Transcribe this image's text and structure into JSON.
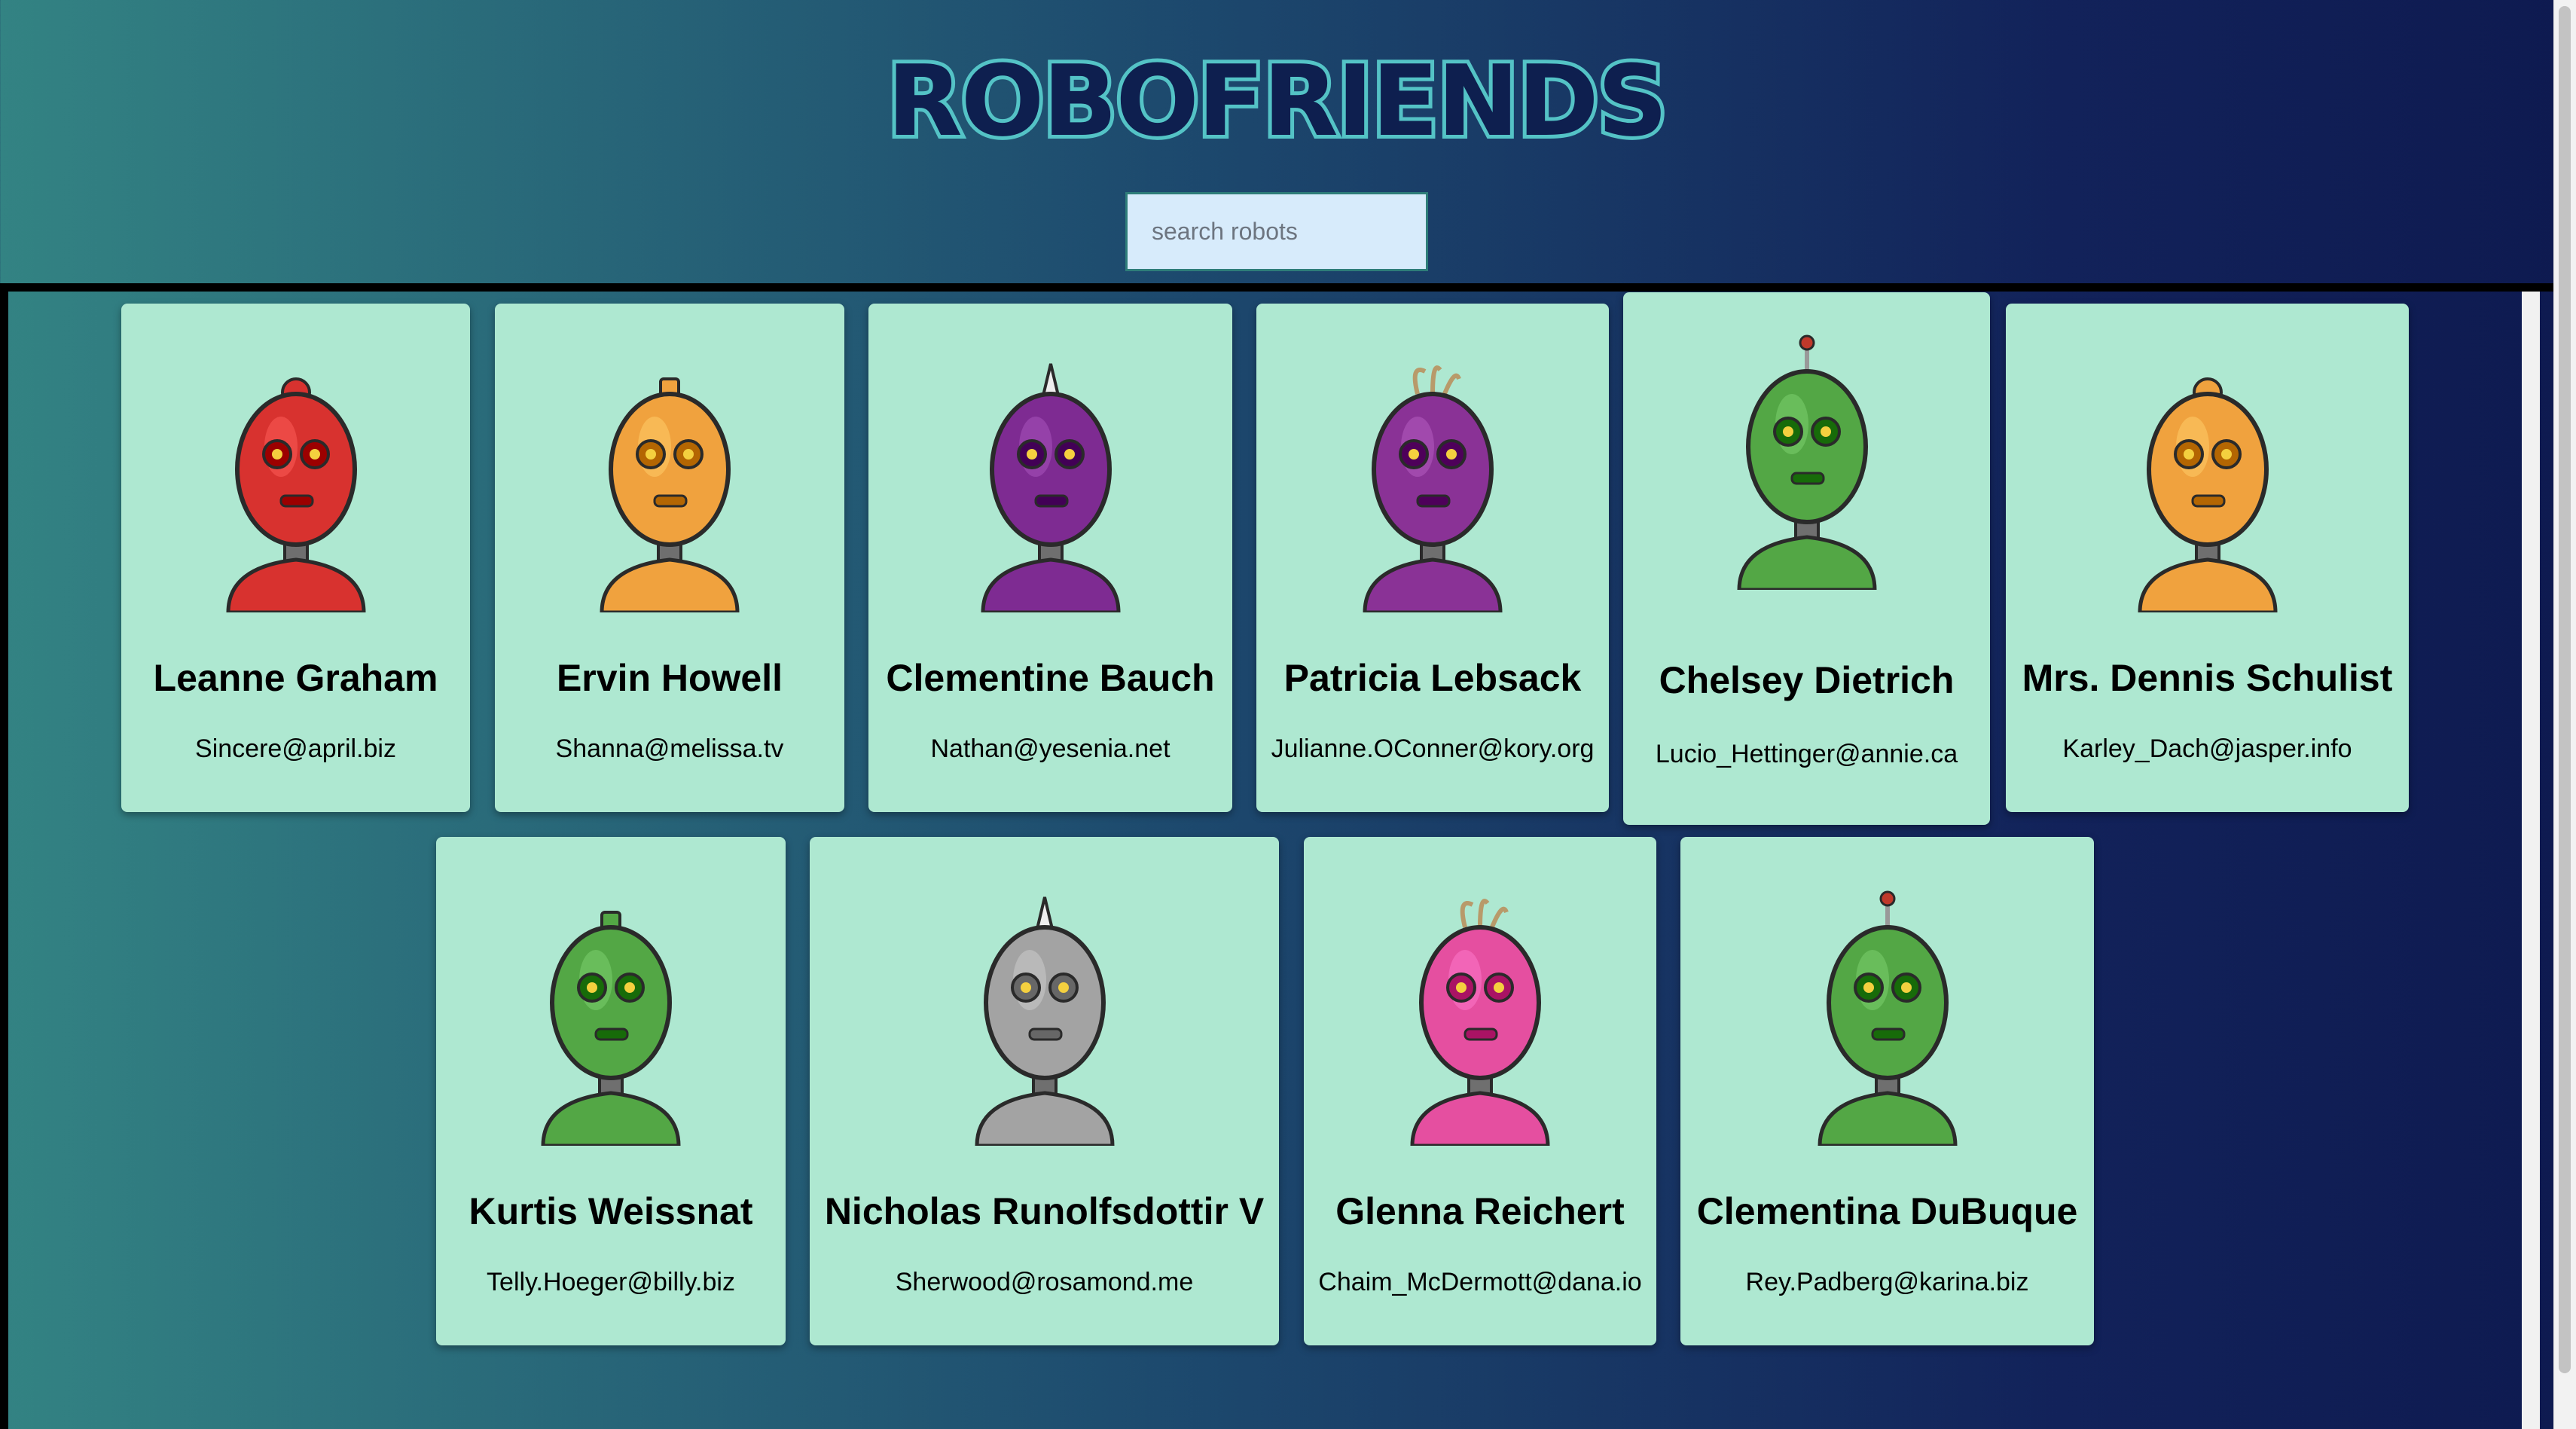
{
  "app": {
    "title": "ROBOFRIENDS"
  },
  "search": {
    "placeholder": "search robots",
    "value": ""
  },
  "robots": [
    {
      "name": "Leanne Graham",
      "email": "Sincere@april.biz",
      "color": "#d8322f",
      "icon": "robot-avatar"
    },
    {
      "name": "Ervin Howell",
      "email": "Shanna@melissa.tv",
      "color": "#f0a23e",
      "icon": "robot-avatar"
    },
    {
      "name": "Clementine Bauch",
      "email": "Nathan@yesenia.net",
      "color": "#7e2b92",
      "icon": "robot-avatar"
    },
    {
      "name": "Patricia Lebsack",
      "email": "Julianne.OConner@kory.org",
      "color": "#8a3296",
      "icon": "robot-avatar"
    },
    {
      "name": "Chelsey Dietrich",
      "email": "Lucio_Hettinger@annie.ca",
      "color": "#53a745",
      "icon": "robot-avatar"
    },
    {
      "name": "Mrs. Dennis Schulist",
      "email": "Karley_Dach@jasper.info",
      "color": "#f0a23e",
      "icon": "robot-avatar"
    },
    {
      "name": "Kurtis Weissnat",
      "email": "Telly.Hoeger@billy.biz",
      "color": "#53a745",
      "icon": "robot-avatar"
    },
    {
      "name": "Nicholas Runolfsdottir V",
      "email": "Sherwood@rosamond.me",
      "color": "#a3a3a3",
      "icon": "robot-avatar"
    },
    {
      "name": "Glenna Reichert",
      "email": "Chaim_McDermott@dana.io",
      "color": "#e54fa0",
      "icon": "robot-avatar"
    },
    {
      "name": "Clementina DuBuque",
      "email": "Rey.Padberg@karina.biz",
      "color": "#53a745",
      "icon": "robot-avatar"
    }
  ]
}
